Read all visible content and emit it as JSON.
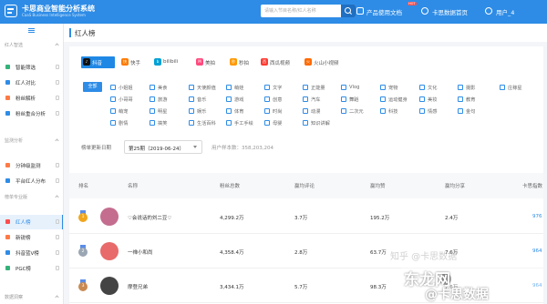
{
  "header": {
    "brand": "卡思商业智能分析系统",
    "brand_sub": "CaaS Business Intelligence System",
    "search_placeholder": "请输入节目名称/红人名称",
    "nav": {
      "docs": "产品使用文档",
      "home": "卡思数据首页",
      "user": "用户_4"
    },
    "hot_badge": "HOT"
  },
  "sidebar": {
    "sections": [
      {
        "title": "红人智选",
        "items": [
          {
            "label": "智能筛选",
            "icon": "filter-icon",
            "color": "#34b27a"
          },
          {
            "label": "红人对比",
            "icon": "compare-icon",
            "color": "#2e8ce6"
          },
          {
            "label": "粉丝解析",
            "icon": "fans-icon",
            "color": "#ff7a45"
          },
          {
            "label": "粉丝重合分析",
            "icon": "overlap-icon",
            "color": "#2e8ce6"
          }
        ]
      },
      {
        "title": "监测分析",
        "items": [
          {
            "label": "分钟级监测",
            "icon": "monitor-icon",
            "color": "#ff7a45"
          },
          {
            "label": "平台红人分布",
            "icon": "distribution-icon",
            "color": "#2e8ce6"
          }
        ]
      },
      {
        "title": "榜单专业版",
        "items": [
          {
            "label": "红人榜",
            "icon": "ranking-icon",
            "color": "#ff4d4f"
          },
          {
            "label": "新锐榜",
            "icon": "rising-icon",
            "color": "#ff7a45"
          },
          {
            "label": "抖音蓝V榜",
            "icon": "bluev-icon",
            "color": "#2e8ce6"
          },
          {
            "label": "PGC榜",
            "icon": "pgc-icon",
            "color": "#34b27a"
          }
        ]
      },
      {
        "title": "数据洞察",
        "items": []
      }
    ]
  },
  "page": {
    "title": "红人榜"
  },
  "platforms": [
    {
      "label": "抖音",
      "color": "#111111",
      "glyph": "♪"
    },
    {
      "label": "快手",
      "color": "#ff7a00",
      "glyph": "快"
    },
    {
      "label": "bilibili",
      "color": "#00a1d6",
      "glyph": "b"
    },
    {
      "label": "美拍",
      "color": "#ff4a7d",
      "glyph": "M"
    },
    {
      "label": "秒拍",
      "color": "#ff9900",
      "glyph": "秒"
    },
    {
      "label": "西瓜视频",
      "color": "#ff3b30",
      "glyph": "西"
    },
    {
      "label": "火山小视频",
      "color": "#ff6a00",
      "glyph": "火"
    }
  ],
  "categories": {
    "all": "全部",
    "items": [
      "小姐姐",
      "小哥哥",
      "萌宠",
      "剧情",
      "美食",
      "旅游",
      "明星",
      "搞笑",
      "天使颜值",
      "音乐",
      "娱乐",
      "生活百科",
      "萌娃",
      "游戏",
      "体育",
      "手工手绘",
      "文字",
      "创意",
      "时尚",
      "母婴",
      "正能量",
      "汽车",
      "动漫",
      "知识讲解",
      "Vlog",
      "舞蹈",
      "二次元",
      "宠物",
      "运动健身",
      "科技",
      "文化",
      "美妆",
      "情感",
      "摄影",
      "教育",
      "金句",
      "庄稼星"
    ]
  },
  "filter": {
    "label": "榜单更新日期",
    "period": "第25期（2019-06-24）",
    "sample": "用户样本数：358,203,204"
  },
  "table": {
    "headers": [
      "排名",
      "名称",
      "粉丝总数",
      "赢均评论",
      "赢均赞",
      "赢均分享",
      "卡思指数"
    ],
    "rows": [
      {
        "rank": "1",
        "medal": "#f0a61c",
        "avatar": "#c46d8f",
        "name": "♡会说话的刘二豆♡",
        "fans": "4,299.2万",
        "comments": "3.7万",
        "likes": "195.2万",
        "shares": "2.4万",
        "index": "976"
      },
      {
        "rank": "2",
        "medal": "#9aa6b3",
        "avatar": "#e86a6a",
        "name": "一禅小和尚",
        "fans": "4,358.4万",
        "comments": "2.8万",
        "likes": "63.7万",
        "shares": "7.6万",
        "index": "964"
      },
      {
        "rank": "3",
        "medal": "#c98a52",
        "avatar": "#444444",
        "name": "摩登兄弟",
        "fans": "3,434.1万",
        "comments": "5.7万",
        "likes": "98.3万",
        "shares": "7.6万",
        "index": "964"
      }
    ]
  },
  "watermark": {
    "line1": "东龙网",
    "line2": "@卡思数据",
    "faint": "知乎 @卡思数据"
  }
}
